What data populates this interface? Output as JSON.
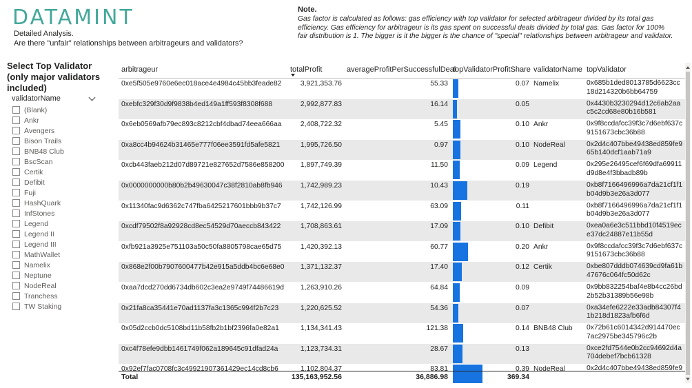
{
  "header": {
    "logo": "DATAMINT",
    "subtitle_1": "Detailed Analysis.",
    "subtitle_2": "Are there \"unfair\" relationships between arbitrageurs and validators?"
  },
  "note": {
    "title": "Note.",
    "body": "Gas factor is calculated as follows: gas efficiency with top validator for selected arbitrageur divided by its total gas efficiency. Gas efficiency for arbitrageur is its gas spent on successful deals divided by total gas. Gas factor for 100% fair distribution is 1. The bigger is it the bigger is the chance of \"special\" relationships between arbitrageur and validator."
  },
  "slicer": {
    "title": "Select Top Validator (only major validators included)",
    "field": "validatorName",
    "items": [
      "(Blank)",
      "Ankr",
      "Avengers",
      "Bison Trails",
      "BNB48 Club",
      "BscScan",
      "Certik",
      "Defibit",
      "Fuji",
      "HashQuark",
      "InfStones",
      "Legend",
      "Legend II",
      "Legend III",
      "MathWallet",
      "Namelix",
      "Neptune",
      "NodeReal",
      "Tranchess",
      "TW Staking"
    ]
  },
  "table": {
    "columns": {
      "arbitrageur": "arbitrageur",
      "totalProfit": "totalProfit",
      "averageProfit": "averageProfitPerSuccessfulDeal",
      "share": "topValidatorProfitShare",
      "validatorName": "validatorName",
      "topValidator": "topValidator"
    },
    "rows": [
      {
        "arbitrageur": "0xe5f505e9760e6ec018ace4e4984c45bb3feade82",
        "totalProfit": "3,921,353.76",
        "averageProfit": "55.33",
        "share": "0.07",
        "share_value": 0.07,
        "validatorName": "Namelix",
        "topValidator": "0x685b1ded8013785d6623cc18d214320b6bb64759"
      },
      {
        "arbitrageur": "0xebfc329f30d9f9838b4ed149a1ff593f8308f688",
        "totalProfit": "2,992,877.83",
        "averageProfit": "16.14",
        "share": "0.05",
        "share_value": 0.05,
        "validatorName": "",
        "topValidator": "0x4430b3230294d12c6ab2aac5c2cd68e80b16b581"
      },
      {
        "arbitrageur": "0x6eb0569afb79ec893c8212cbf4dbad74eea666aa",
        "totalProfit": "2,408,722.32",
        "averageProfit": "5.45",
        "share": "0.10",
        "share_value": 0.1,
        "validatorName": "Ankr",
        "topValidator": "0x9f8ccdafcc39f3c7d6ebf637c9151673cbc36b88"
      },
      {
        "arbitrageur": "0xa8cc4b94624b31465e777f06ee3591fd5afe5821",
        "totalProfit": "1,995,726.50",
        "averageProfit": "0.97",
        "share": "0.10",
        "share_value": 0.1,
        "validatorName": "NodeReal",
        "topValidator": "0x2d4c407bbe49438ed859fe965b140dcf1aab71a9"
      },
      {
        "arbitrageur": "0xcb443faeb212d07d89721e827652d7586e858200",
        "totalProfit": "1,897,749.39",
        "averageProfit": "11.50",
        "share": "0.09",
        "share_value": 0.09,
        "validatorName": "Legend",
        "topValidator": "0x295e26495cef6f69dfa69911d9d8e4f3bbadb89b"
      },
      {
        "arbitrageur": "0x0000000000b80b2b49630047c38f2810ab8fb946",
        "totalProfit": "1,742,989.23",
        "averageProfit": "10.43",
        "share": "0.19",
        "share_value": 0.19,
        "validatorName": "",
        "topValidator": "0xb8f7166496996a7da21cf1f1b04d9b3e26a3d077"
      },
      {
        "arbitrageur": "0x11340fac9d6362c747fba6425217601bbb9b37c7",
        "totalProfit": "1,742,126.99",
        "averageProfit": "63.09",
        "share": "0.11",
        "share_value": 0.11,
        "validatorName": "",
        "topValidator": "0xb8f7166496996a7da21cf1f1b04d9b3e26a3d077"
      },
      {
        "arbitrageur": "0xcdf79502f8a92928cd8ec54529d70aeccb843422",
        "totalProfit": "1,708,863.61",
        "averageProfit": "17.09",
        "share": "0.10",
        "share_value": 0.1,
        "validatorName": "Defibit",
        "topValidator": "0xea0a6e3c511bbd10f4519ece37dc24887e11b55d"
      },
      {
        "arbitrageur": "0xfb921a3925e751103a50c50fa8805798cae65d75",
        "totalProfit": "1,420,392.13",
        "averageProfit": "60.77",
        "share": "0.20",
        "share_value": 0.2,
        "validatorName": "Ankr",
        "topValidator": "0x9f8ccdafcc39f3c7d6ebf637c9151673cbc36b88"
      },
      {
        "arbitrageur": "0x868e2f00b7907600477b42e915a5ddb4bc6e68e0",
        "totalProfit": "1,371,132.37",
        "averageProfit": "17.40",
        "share": "0.12",
        "share_value": 0.12,
        "validatorName": "Certik",
        "topValidator": "0xbe807dddb074639cd9fa61b47676c064fc50d62c"
      },
      {
        "arbitrageur": "0xaa7dcd270dd6734db602c3ea2e9749f74486619d",
        "totalProfit": "1,263,910.26",
        "averageProfit": "64.84",
        "share": "0.09",
        "share_value": 0.09,
        "validatorName": "",
        "topValidator": "0x9bb832254baf4e8b4cc26bd2b52b31389b56e98b"
      },
      {
        "arbitrageur": "0x21fa8ca35441e70ad1137fa3c1365c994f2b7c23",
        "totalProfit": "1,220,625.52",
        "averageProfit": "54.36",
        "share": "0.07",
        "share_value": 0.07,
        "validatorName": "",
        "topValidator": "0xa34efe6222e33adb84307f41b218d1823afb6f6d"
      },
      {
        "arbitrageur": "0x05d2ccb0dc5108bd11b58fb2b1bf2396fa0e82a1",
        "totalProfit": "1,134,341.43",
        "averageProfit": "121.38",
        "share": "0.14",
        "share_value": 0.14,
        "validatorName": "BNB48 Club",
        "topValidator": "0x72b61c6014342d914470ec7ac2975be345796c2b"
      },
      {
        "arbitrageur": "0xc4f78efe9dbb1461749f062a189645c91dfad24a",
        "totalProfit": "1,123,734.31",
        "averageProfit": "28.67",
        "share": "0.13",
        "share_value": 0.13,
        "validatorName": "",
        "topValidator": "0xce2fd7544e0b2cc94692d4a704debef7bcb61328"
      },
      {
        "arbitrageur": "0x92ef7fac0708fc3c49921907361429ec14cd8cb6",
        "totalProfit": "1,102,804.37",
        "averageProfit": "83.81",
        "share": "0.39",
        "share_value": 0.39,
        "validatorName": "NodeReal",
        "topValidator": "0x2d4c407bbe49438ed859fe9"
      }
    ],
    "total": {
      "label": "Total",
      "totalProfit": "135,163,952.56",
      "averageProfit": "36,886.98",
      "share": "369.34"
    },
    "bar_color": "#1673e0"
  }
}
